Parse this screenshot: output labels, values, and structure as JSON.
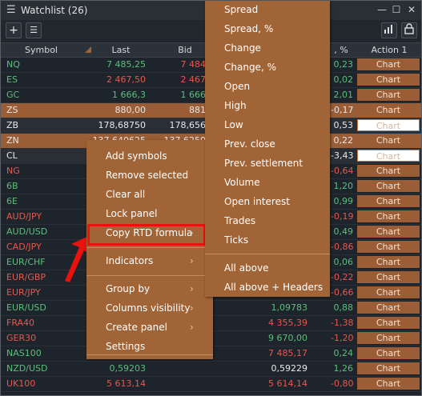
{
  "window": {
    "title": "Watchlist (26)",
    "menu_glyph": "☰",
    "minimize": "—",
    "maximize": "☐",
    "close": "✕"
  },
  "toolbar": {
    "add": "+",
    "list": "☰"
  },
  "header": {
    "symbol": "Symbol",
    "last": "Last",
    "bid": "Bid",
    "pct": ", %",
    "action": "Action 1"
  },
  "rows": [
    {
      "sym": "NQ",
      "last": "7 485,25",
      "bid": "7 484",
      "pct": "0,23",
      "c_sym": "green",
      "c_last": "green",
      "c_bid": "red",
      "c_pct": "green",
      "chart": "Chart",
      "sel": ""
    },
    {
      "sym": "ES",
      "last": "2 467,50",
      "bid": "2 467",
      "pct": "0,02",
      "c_sym": "green",
      "c_last": "red",
      "c_bid": "red",
      "c_pct": "green",
      "chart": "Chart",
      "sel": ""
    },
    {
      "sym": "GC",
      "last": "1 666,3",
      "bid": "1 666",
      "pct": "2,01",
      "c_sym": "green",
      "c_last": "green",
      "c_bid": "green",
      "c_pct": "green",
      "chart": "Chart",
      "sel": ""
    },
    {
      "sym": "ZS",
      "last": "880,00",
      "bid": "881",
      "pct": "-0,17",
      "c_sym": "white",
      "c_last": "white",
      "c_bid": "white",
      "c_pct": "white",
      "chart": "Chart",
      "sel": "sel"
    },
    {
      "sym": "ZB",
      "last": "178,68750",
      "bid": "178,656",
      "pct": "0,53",
      "c_sym": "white",
      "c_last": "white",
      "c_bid": "white",
      "c_pct": "white",
      "chart": "Chart",
      "sel": "selw"
    },
    {
      "sym": "ZN",
      "last": "137,640625",
      "bid": "137,6250",
      "pct": "0,22",
      "c_sym": "white",
      "c_last": "white",
      "c_bid": "white",
      "c_pct": "white",
      "chart": "Chart",
      "sel": "sel"
    },
    {
      "sym": "CL",
      "last": "",
      "bid": "",
      "pct": "-3,43",
      "c_sym": "white",
      "c_last": "white",
      "c_bid": "white",
      "c_pct": "white",
      "chart": "Chart",
      "sel": "selw"
    },
    {
      "sym": "NG",
      "last": "",
      "bid": "",
      "pct": "-0,64",
      "c_sym": "red",
      "c_last": "red",
      "c_bid": "red",
      "c_pct": "red",
      "chart": "Chart",
      "sel": ""
    },
    {
      "sym": "6B",
      "last": "",
      "bid": "",
      "pct": "1,20",
      "c_sym": "green",
      "c_last": "green",
      "c_bid": "green",
      "c_pct": "green",
      "chart": "Chart",
      "sel": ""
    },
    {
      "sym": "6E",
      "last": "",
      "bid": "",
      "pct": "0,99",
      "c_sym": "green",
      "c_last": "green",
      "c_bid": "green",
      "c_pct": "green",
      "chart": "Chart",
      "sel": ""
    },
    {
      "sym": "AUD/JPY",
      "last": "",
      "bid": "",
      "pct": "-0,19",
      "c_sym": "red",
      "c_last": "red",
      "c_bid": "red",
      "c_pct": "red",
      "chart": "Chart",
      "sel": ""
    },
    {
      "sym": "AUD/USD",
      "last": "",
      "bid": "",
      "pct": "0,49",
      "c_sym": "green",
      "c_last": "green",
      "c_bid": "green",
      "c_pct": "green",
      "chart": "Chart",
      "sel": ""
    },
    {
      "sym": "CAD/JPY",
      "last": "",
      "bid": "",
      "pct": "-0,86",
      "c_sym": "red",
      "c_last": "red",
      "c_bid": "red",
      "c_pct": "red",
      "chart": "Chart",
      "sel": ""
    },
    {
      "sym": "EUR/CHF",
      "last": "",
      "bid": "",
      "pct": "0,06",
      "c_sym": "green",
      "c_last": "green",
      "c_bid": "green",
      "c_pct": "green",
      "chart": "Chart",
      "sel": ""
    },
    {
      "sym": "EUR/GBP",
      "last": "",
      "bid": "",
      "pct": "-0,22",
      "c_sym": "red",
      "c_last": "red",
      "c_bid": "red",
      "c_pct": "red",
      "chart": "Chart",
      "sel": ""
    },
    {
      "sym": "EUR/JPY",
      "last": "",
      "bid": "",
      "pct": "-0,66",
      "c_sym": "red",
      "c_last": "red",
      "c_bid": "red",
      "c_pct": "red",
      "chart": "Chart",
      "sel": ""
    },
    {
      "sym": "EUR/USD",
      "last": "",
      "bid": "770",
      "bid2": "1,09783",
      "pct": "0,88",
      "c_sym": "green",
      "c_last": "green",
      "c_bid": "green",
      "c_pct": "green",
      "chart": "Chart",
      "sel": ""
    },
    {
      "sym": "FRA40",
      "last": "",
      "bid": "39",
      "bid2": "4 355,39",
      "pct": "-1,38",
      "c_sym": "red",
      "c_last": "red",
      "c_bid": "red",
      "c_pct": "red",
      "chart": "Chart",
      "sel": ""
    },
    {
      "sym": "GER30",
      "last": "",
      "bid": "00",
      "bid2": "9 670,00",
      "pct": "-1,20",
      "c_sym": "red",
      "c_last": "red",
      "c_bid": "green",
      "c_pct": "red",
      "chart": "Chart",
      "sel": ""
    },
    {
      "sym": "NAS100",
      "last": "",
      "bid": "17",
      "bid2": "7 485,17",
      "pct": "0,24",
      "c_sym": "green",
      "c_last": "green",
      "c_bid": "red",
      "c_pct": "green",
      "chart": "Chart",
      "sel": ""
    },
    {
      "sym": "NZD/USD",
      "last": "0,59203",
      "bid": "",
      "bid2": "0,59229",
      "pct": "1,26",
      "c_sym": "green",
      "c_last": "green",
      "c_bid": "white",
      "c_pct": "green",
      "chart": "Chart",
      "sel": ""
    },
    {
      "sym": "UK100",
      "last": "5 613,14",
      "bid": "",
      "bid2": "5 614,14",
      "pct": "-0,80",
      "c_sym": "red",
      "c_last": "red",
      "c_bid": "red",
      "c_pct": "red",
      "chart": "Chart",
      "sel": ""
    }
  ],
  "context_menu": {
    "items": [
      {
        "label": "Add symbols",
        "arrow": ""
      },
      {
        "label": "Remove selected",
        "arrow": ""
      },
      {
        "label": "Clear all",
        "arrow": ""
      },
      {
        "label": "Lock panel",
        "arrow": ""
      },
      {
        "label": "Copy RTD formula",
        "arrow": "›"
      },
      {
        "label": "Indicators",
        "arrow": "›"
      },
      {
        "label": "Group by",
        "arrow": "›"
      },
      {
        "label": "Columns visibility",
        "arrow": "›"
      },
      {
        "label": "Create panel",
        "arrow": "›"
      },
      {
        "label": "Settings",
        "arrow": ""
      }
    ]
  },
  "submenu": {
    "items": [
      "Spread",
      "Spread, %",
      "Change",
      "Change, %",
      "Open",
      "High",
      "Low",
      "Prev. close",
      "Prev. settlement",
      "Volume",
      "Open interest",
      "Trades",
      "Ticks",
      "All above",
      "All above + Headers"
    ]
  },
  "colors": {
    "accent": "#9b5d35",
    "menu": "#a06437",
    "positive": "#5cbf7c",
    "negative": "#e4584f",
    "highlight": "#e8120f"
  }
}
